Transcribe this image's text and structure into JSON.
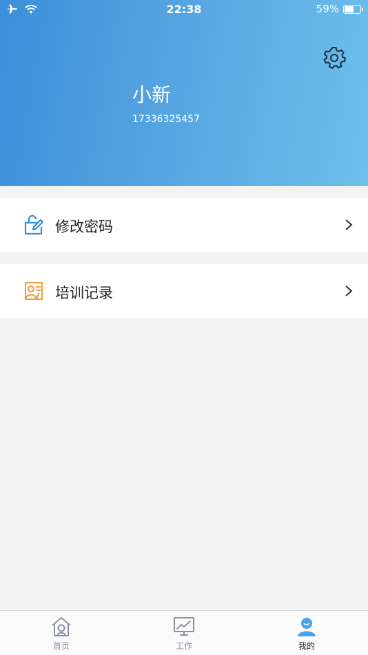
{
  "status_bar": {
    "time": "22:38",
    "battery_percent": "59%",
    "battery_level": 0.59,
    "icons": [
      "airplane-icon",
      "wifi-icon",
      "battery-icon"
    ]
  },
  "profile": {
    "name": "小新",
    "phone": "17336325457",
    "settings_icon": "gear-icon"
  },
  "menu": {
    "items": [
      {
        "label": "修改密码",
        "icon": "edit-lock-icon",
        "icon_color": "#2c8ee0"
      },
      {
        "label": "培训记录",
        "icon": "training-record-icon",
        "icon_color": "#f0a04b"
      }
    ]
  },
  "tabbar": {
    "tabs": [
      {
        "label": "首页",
        "icon": "home-icon"
      },
      {
        "label": "工作",
        "icon": "chart-monitor-icon"
      },
      {
        "label": "我的",
        "icon": "user-icon",
        "active": true
      }
    ]
  },
  "colors": {
    "header_start": "#3c8fd9",
    "header_end": "#6cc0ec",
    "background": "#f3f3f3",
    "tab_inactive": "#8a8fa0",
    "tab_active_icon": "#4aa3e6"
  }
}
